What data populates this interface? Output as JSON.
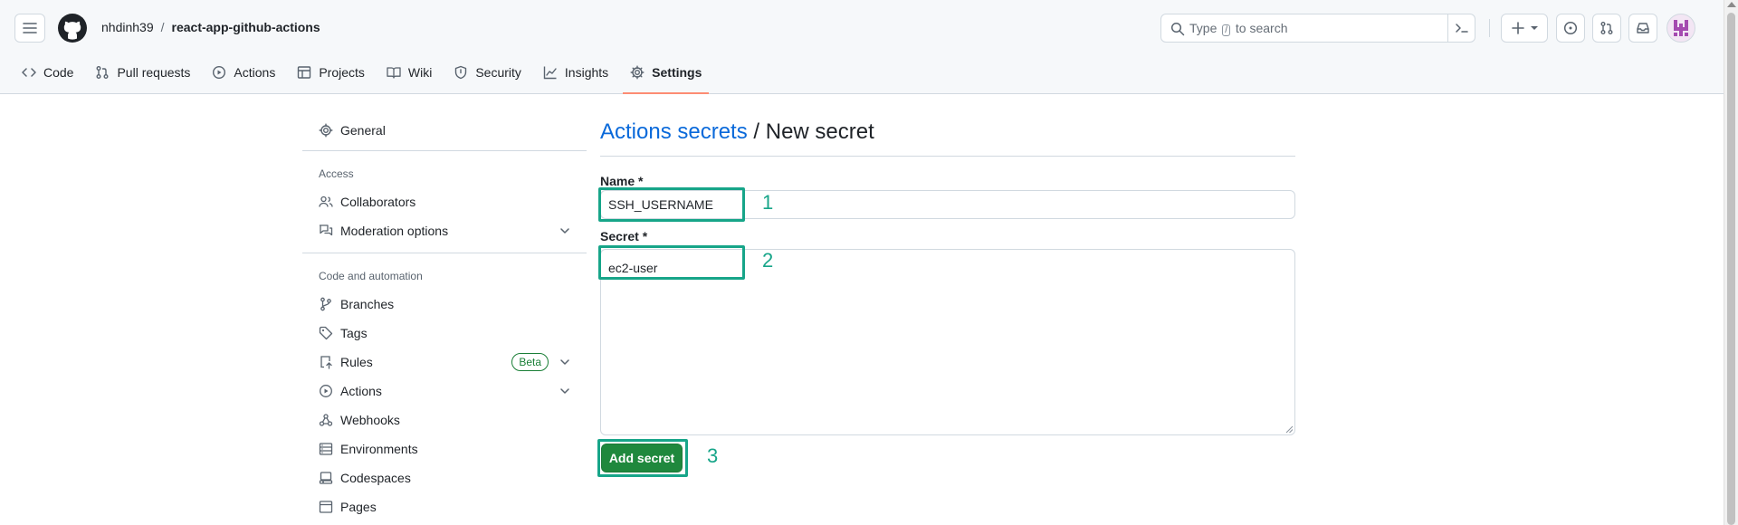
{
  "header": {
    "owner": "nhdinh39",
    "separator": "/",
    "repo": "react-app-github-actions",
    "search_before": "Type",
    "search_key": "/",
    "search_after": "to search"
  },
  "tabs": [
    {
      "label": "Code",
      "icon": "code-icon"
    },
    {
      "label": "Pull requests",
      "icon": "git-pull-request-icon"
    },
    {
      "label": "Actions",
      "icon": "play-circle-icon"
    },
    {
      "label": "Projects",
      "icon": "table-icon"
    },
    {
      "label": "Wiki",
      "icon": "book-icon"
    },
    {
      "label": "Security",
      "icon": "shield-icon"
    },
    {
      "label": "Insights",
      "icon": "graph-icon"
    },
    {
      "label": "Settings",
      "icon": "gear-icon",
      "selected": true
    }
  ],
  "sidebar": {
    "general": "General",
    "access_heading": "Access",
    "collaborators": "Collaborators",
    "moderation": "Moderation options",
    "code_heading": "Code and automation",
    "branches": "Branches",
    "tags": "Tags",
    "rules": "Rules",
    "rules_badge": "Beta",
    "actions": "Actions",
    "webhooks": "Webhooks",
    "environments": "Environments",
    "codespaces": "Codespaces",
    "pages": "Pages"
  },
  "main": {
    "title_link": "Actions secrets",
    "title_rest": " / New secret",
    "name_label": "Name *",
    "name_value": "SSH_USERNAME",
    "secret_label": "Secret *",
    "secret_value": "ec2-user",
    "submit_label": "Add secret"
  },
  "annotations": {
    "step1": "1",
    "step2": "2",
    "step3": "3"
  },
  "colors": {
    "accent_link": "#0969da",
    "primary_button": "#1f883d",
    "selected_tab_underline": "#fd8c73",
    "annotation": "#17a589"
  }
}
